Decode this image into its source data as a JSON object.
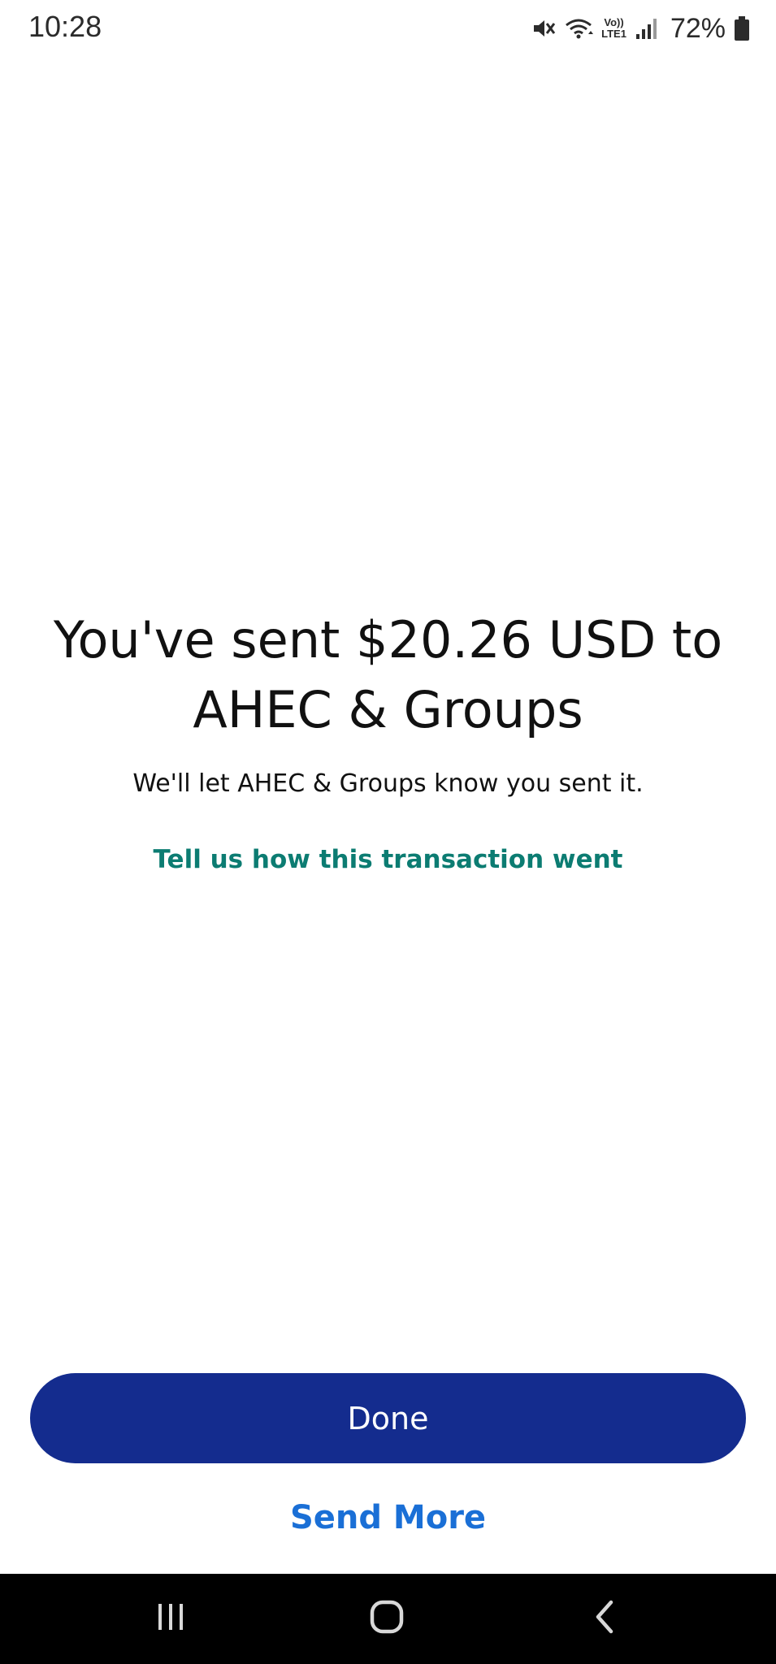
{
  "status_bar": {
    "time": "10:28",
    "lte_top": "Vo))",
    "lte_bottom": "LTE1",
    "battery_percent": "72%",
    "icons": [
      "mute-icon",
      "wifi-icon",
      "volte-icon",
      "signal-icon",
      "battery-icon"
    ]
  },
  "confirmation": {
    "headline": "You've sent $20.26 USD to AHEC & Groups",
    "subtext": "We'll let AHEC & Groups know you sent it.",
    "feedback_link": "Tell us how this transaction went"
  },
  "actions": {
    "done_label": "Done",
    "send_more_label": "Send More"
  },
  "nav_bar": {
    "icons": [
      "recent-apps-icon",
      "home-icon",
      "back-icon"
    ]
  },
  "colors": {
    "done_button": "#142c8e",
    "feedback_link": "#0c7c72",
    "send_more": "#1a6fd6"
  }
}
